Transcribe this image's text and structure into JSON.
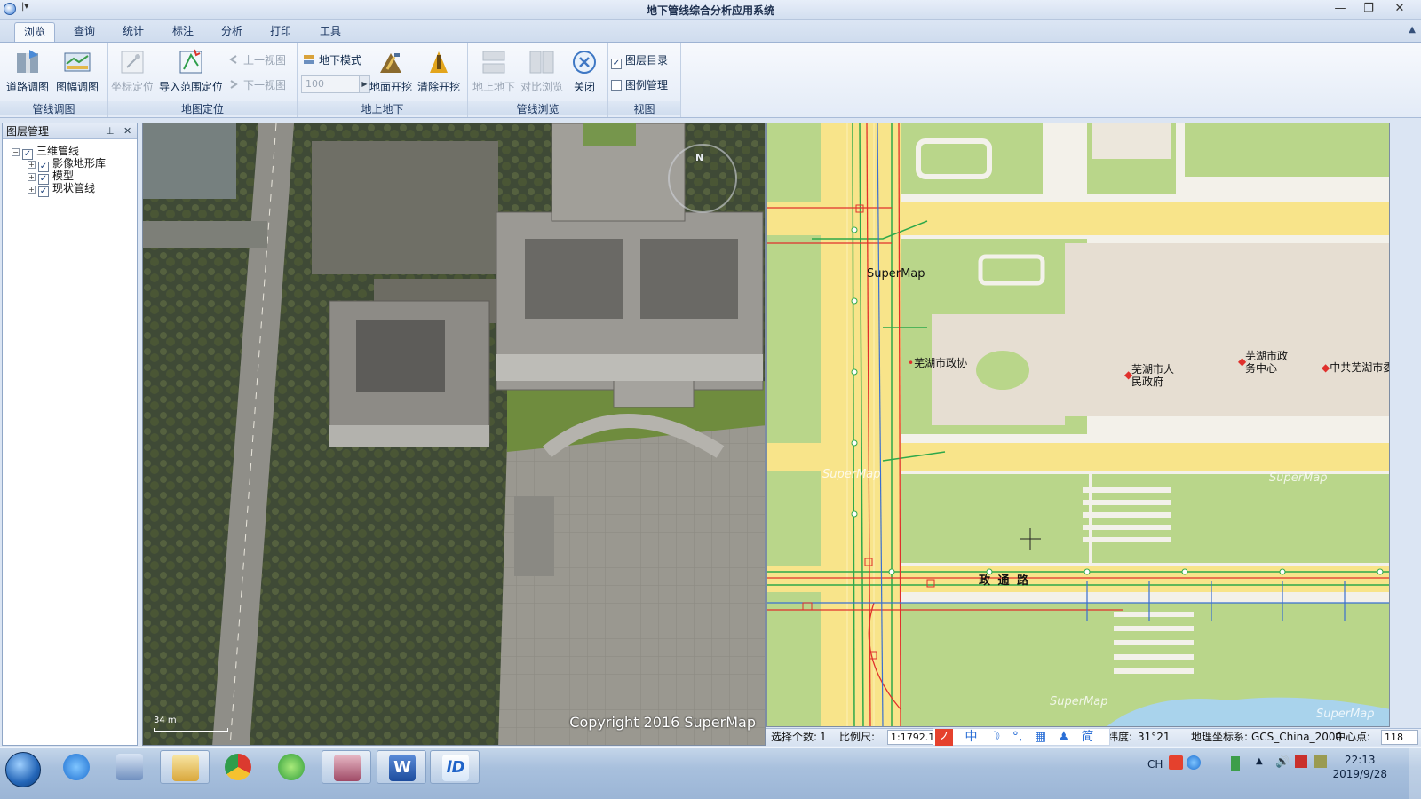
{
  "window": {
    "title": "地下管线综合分析应用系统",
    "quick_access": "|▾",
    "controls": {
      "minimize": "—",
      "restore": "❐",
      "close": "✕"
    }
  },
  "tabs": [
    "浏览",
    "查询",
    "统计",
    "标注",
    "分析",
    "打印",
    "工具"
  ],
  "active_tab": "浏览",
  "ribbon": {
    "groups": {
      "pipeline_view": {
        "label": "管线调图",
        "road_map": "道路调图",
        "sheet_map": "图幅调图"
      },
      "map_locate": {
        "label": "地图定位",
        "coord_locate": "坐标定位",
        "import_range_locate": "导入范围定位",
        "prev_view": "上一视图",
        "next_view": "下一视图"
      },
      "above_below": {
        "label": "地上地下",
        "underground_mode": "地下模式",
        "depth_value": "100",
        "ground_excavate": "地面开挖",
        "clear_excavate": "清除开挖"
      },
      "pipeline_browse": {
        "label": "管线浏览",
        "above_below_ground": "地上地下",
        "compare_browse": "对比浏览",
        "close": "关闭"
      },
      "view": {
        "label": "视图",
        "layer_catalog": "图层目录",
        "layer_catalog_checked": true,
        "legend_manage": "图例管理",
        "legend_manage_checked": false
      }
    }
  },
  "layer_panel": {
    "title": "图层管理",
    "root": "三维管线",
    "children": [
      "影像地形库",
      "模型",
      "现状管线"
    ]
  },
  "left_view": {
    "copyright": "Copyright 2016 SuperMap",
    "scale": "34 m",
    "compass": "N"
  },
  "right_view": {
    "watermark": "SuperMap",
    "road_label": "政 通 路",
    "poi": [
      {
        "name": "芜湖市政协"
      },
      {
        "name": "芜湖市人民政府",
        "line1": "芜湖市人",
        "line2": "民政府"
      },
      {
        "name": "芜湖市政务中心",
        "line1": "芜湖市政",
        "line2": "务中心"
      },
      {
        "name": "中共芜湖市委"
      }
    ],
    "poi_label_4": "中共芜湖市委"
  },
  "statusbar": {
    "selected_label": "选择个数:",
    "selected_value": "1",
    "scale_label": "比例尺:",
    "scale_value": "1:1792.1",
    "latitude_label": "纬度:",
    "latitude_value": "31°21",
    "crs_label": "地理坐标系:",
    "crs_value": "GCS_China_2000",
    "center_label": "中心点:",
    "center_value": "118"
  },
  "ime": [
    "中",
    "☽",
    "°,",
    "▦",
    "♟",
    "简",
    "👕",
    "⚙"
  ],
  "taskbar": {
    "apps": [
      "internet-explorer",
      "network-tool",
      "file-explorer",
      "chrome",
      "browser-360",
      "database-app",
      "word",
      "supermap-idesktop"
    ],
    "tray_lang": "CH",
    "time": "22:13",
    "date": "2019/9/28"
  },
  "colors": {
    "road_yellow": "#f8e48a",
    "green_area": "#b9d68a",
    "building_gray": "#e6ded2",
    "pipe_red": "#e0302c",
    "pipe_green": "#2ea84a",
    "pipe_blue": "#3a6fd0"
  }
}
